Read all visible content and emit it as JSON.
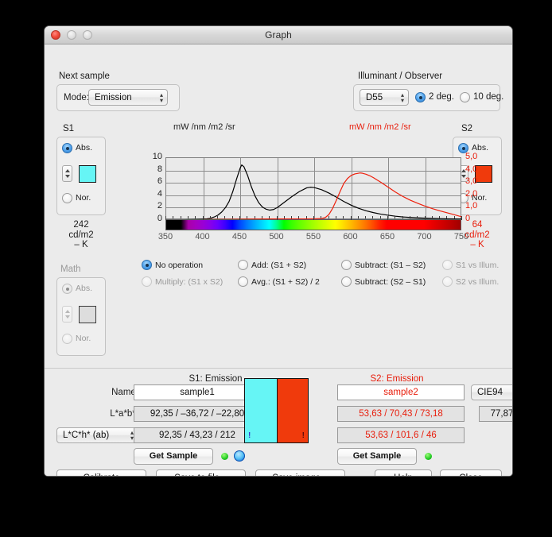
{
  "window": {
    "title": "Graph"
  },
  "next_sample": {
    "group_label": "Next sample",
    "mode_label": "Mode:",
    "mode_value": "Emission"
  },
  "illuminant": {
    "group_label": "Illuminant / Observer",
    "illuminant_value": "D55",
    "observer_2": "2 deg.",
    "observer_10": "10 deg."
  },
  "s1_panel": {
    "title": "S1",
    "abs_label": "Abs.",
    "nor_label": "Nor.",
    "color": "#66F5F5",
    "reading_value": "242",
    "reading_unit": "cd/m2",
    "reading_extra": "– K"
  },
  "s2_panel": {
    "title": "S2",
    "abs_label": "Abs.",
    "nor_label": "Nor.",
    "color": "#F03A0C",
    "reading_value": "64",
    "reading_unit": "cd/m2",
    "reading_extra": "– K"
  },
  "math_panel": {
    "title": "Math",
    "abs_label": "Abs.",
    "nor_label": "Nor.",
    "color": "#DDDDDD"
  },
  "operations": [
    {
      "label": "No operation",
      "selected": true,
      "enabled": true
    },
    {
      "label": "Add: (S1 + S2)",
      "selected": false,
      "enabled": true
    },
    {
      "label": "Subtract: (S1 – S2)",
      "selected": false,
      "enabled": true
    },
    {
      "label": "S1 vs Illum.",
      "selected": false,
      "enabled": false
    },
    {
      "label": "Multiply: (S1 x S2)",
      "selected": false,
      "enabled": false
    },
    {
      "label": "Avg.: (S1 + S2) / 2",
      "selected": false,
      "enabled": true
    },
    {
      "label": "Subtract: (S2 – S1)",
      "selected": false,
      "enabled": true
    },
    {
      "label": "S2 vs Illum.",
      "selected": false,
      "enabled": false
    }
  ],
  "sample_form": {
    "name_label": "Name:",
    "lab_label": "L*a*b*:",
    "alt_space_value": "L*C*h* (ab)",
    "get_sample_label": "Get Sample",
    "s1": {
      "header": "S1: Emission",
      "name_value": "sample1",
      "lab_value": "92,35 / –36,72 / –22,80",
      "alt_value": "92,35 / 43,23 / 212"
    },
    "s2": {
      "header": "S2: Emission",
      "name_value": "sample2",
      "lab_value": "53,63 / 70,43 / 73,18",
      "alt_value": "53,63 / 101,6 / 46"
    },
    "delta": {
      "formula_value": "CIE94",
      "delta_value": "77,87"
    },
    "swatch_warning": "!"
  },
  "bottom_buttons": [
    {
      "label": "Calibrate"
    },
    {
      "label": "Save to file..."
    },
    {
      "label": "Save image..."
    },
    {
      "label": "Help"
    },
    {
      "label": "Close"
    }
  ],
  "chart_data": {
    "type": "line",
    "title": "",
    "xlabel": "",
    "ylabel": "mW /nm /m2 /sr",
    "ylabel_right": "mW /nm /m2 /sr",
    "grid": true,
    "legend": "none",
    "xlim": [
      350,
      750
    ],
    "xticks": [
      350,
      400,
      450,
      500,
      550,
      600,
      650,
      700,
      750
    ],
    "ylim_left": [
      0,
      10
    ],
    "yticks_left": [
      "0",
      "2",
      "4",
      "6",
      "8",
      "10"
    ],
    "ylim_right": [
      0,
      5
    ],
    "yticks_right": [
      "0",
      "1,0",
      "2,0",
      "3,0",
      "4,0",
      "5,0"
    ],
    "series": [
      {
        "name": "S1: Emission",
        "color": "#000000",
        "axis": "left",
        "x": [
          350,
          360,
          370,
          380,
          390,
          400,
          405,
          410,
          415,
          420,
          425,
          430,
          435,
          440,
          445,
          450,
          452,
          455,
          460,
          465,
          470,
          475,
          480,
          485,
          490,
          495,
          500,
          510,
          520,
          530,
          540,
          545,
          550,
          560,
          570,
          580,
          590,
          600,
          610,
          620,
          630,
          640,
          650,
          660,
          670,
          680,
          690,
          700,
          710,
          720,
          730,
          740,
          750
        ],
        "y": [
          0.02,
          0.03,
          0.04,
          0.06,
          0.1,
          0.15,
          0.2,
          0.3,
          0.5,
          0.8,
          1.3,
          2.0,
          3.0,
          4.6,
          6.6,
          8.4,
          8.9,
          8.6,
          7.2,
          5.4,
          3.9,
          2.8,
          2.1,
          1.75,
          1.6,
          1.7,
          2.0,
          2.9,
          3.8,
          4.6,
          5.2,
          5.3,
          5.25,
          4.9,
          4.35,
          3.7,
          3.0,
          2.4,
          1.9,
          1.5,
          1.2,
          0.95,
          0.78,
          0.62,
          0.5,
          0.42,
          0.35,
          0.3,
          0.26,
          0.23,
          0.2,
          0.18,
          0.17
        ]
      },
      {
        "name": "S2: Emission",
        "color": "#EE1F0B",
        "axis": "right",
        "x": [
          350,
          370,
          390,
          400,
          420,
          440,
          460,
          480,
          500,
          520,
          540,
          550,
          560,
          565,
          570,
          575,
          580,
          585,
          590,
          595,
          600,
          605,
          610,
          612,
          615,
          620,
          625,
          630,
          640,
          650,
          660,
          670,
          680,
          690,
          700,
          710,
          720,
          730,
          740,
          750
        ],
        "y": [
          0.0,
          0.0,
          0.02,
          0.03,
          0.05,
          0.06,
          0.07,
          0.08,
          0.09,
          0.09,
          0.09,
          0.1,
          0.12,
          0.2,
          0.45,
          0.95,
          1.6,
          2.3,
          2.95,
          3.35,
          3.6,
          3.72,
          3.78,
          3.8,
          3.78,
          3.7,
          3.58,
          3.42,
          3.05,
          2.65,
          2.25,
          1.9,
          1.6,
          1.35,
          1.12,
          0.92,
          0.74,
          0.58,
          0.42,
          0.25
        ]
      }
    ]
  }
}
